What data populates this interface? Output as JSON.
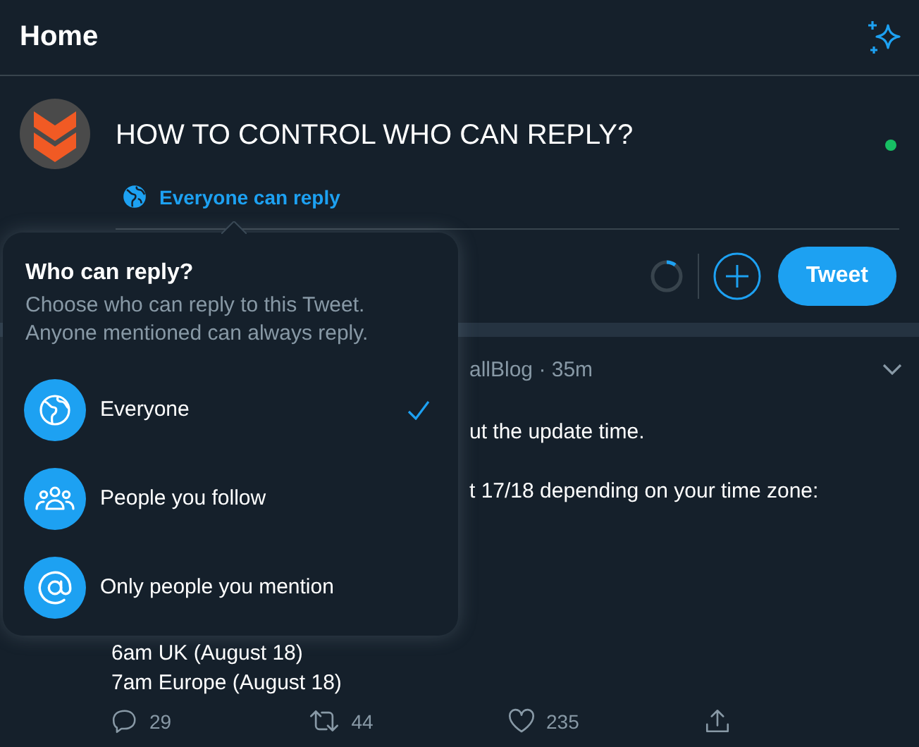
{
  "header": {
    "title": "Home"
  },
  "composer": {
    "text": "HOW TO CONTROL WHO CAN REPLY?",
    "reply_setting": "Everyone can reply",
    "online": true,
    "button": "Tweet"
  },
  "tweet": {
    "meta": "allBlog · 35m",
    "lines": [
      "ut the update time.",
      "t 17/18 depending on your time zone:"
    ],
    "times": [
      "6am UK (August 18)",
      "7am Europe (August 18)"
    ],
    "actions": [
      {
        "kind": "reply",
        "count": "29"
      },
      {
        "kind": "retweet",
        "count": "44"
      },
      {
        "kind": "like",
        "count": "235"
      },
      {
        "kind": "share"
      }
    ]
  },
  "popup": {
    "title": "Who can reply?",
    "description": "Choose who can reply to this Tweet. Anyone mentioned can always reply.",
    "options": [
      {
        "kind": "everyone",
        "label": "Everyone",
        "selected": true
      },
      {
        "kind": "following",
        "label": "People you follow",
        "selected": false
      },
      {
        "kind": "mention",
        "label": "Only people you mention",
        "selected": false
      }
    ]
  }
}
